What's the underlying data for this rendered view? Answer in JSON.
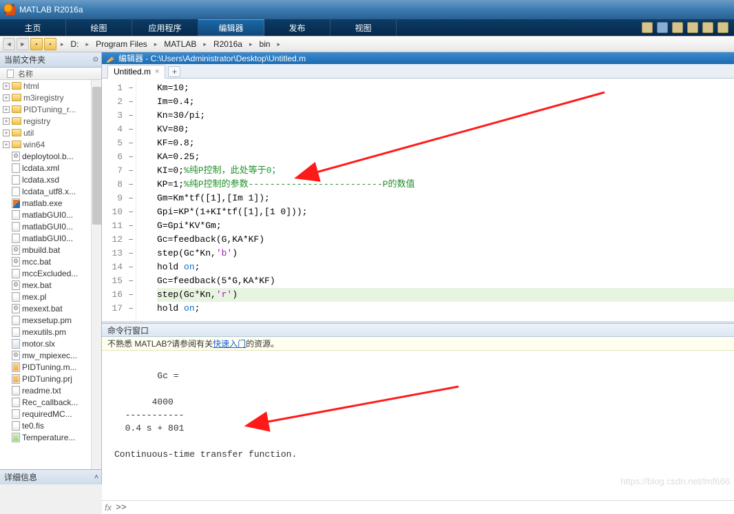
{
  "title_bar": {
    "app_title": "MATLAB R2016a"
  },
  "ribbon": {
    "tabs": [
      "主页",
      "绘图",
      "应用程序",
      "编辑器",
      "发布",
      "视图"
    ],
    "active_index": 3
  },
  "address": {
    "crumbs": [
      "D:",
      "Program Files",
      "MATLAB",
      "R2016a",
      "bin"
    ]
  },
  "file_browser": {
    "header": "当前文件夹",
    "column": "名称",
    "details_header": "详细信息",
    "folders": [
      "html",
      "m3iregistry",
      "PIDTuning_r...",
      "registry",
      "util",
      "win64"
    ],
    "files": [
      {
        "name": "deploytool.b...",
        "type": "bat"
      },
      {
        "name": "lcdata.xml",
        "type": "xml"
      },
      {
        "name": "lcdata.xsd",
        "type": "xml"
      },
      {
        "name": "lcdata_utf8.x...",
        "type": "xml"
      },
      {
        "name": "matlab.exe",
        "type": "exe"
      },
      {
        "name": "matlabGUI0...",
        "type": "m"
      },
      {
        "name": "matlabGUI0...",
        "type": "m"
      },
      {
        "name": "matlabGUI0...",
        "type": "m"
      },
      {
        "name": "mbuild.bat",
        "type": "bat"
      },
      {
        "name": "mcc.bat",
        "type": "bat"
      },
      {
        "name": "mccExcluded...",
        "type": "m"
      },
      {
        "name": "mex.bat",
        "type": "bat"
      },
      {
        "name": "mex.pl",
        "type": "m"
      },
      {
        "name": "mexext.bat",
        "type": "bat"
      },
      {
        "name": "mexsetup.pm",
        "type": "m"
      },
      {
        "name": "mexutils.pm",
        "type": "m"
      },
      {
        "name": "motor.slx",
        "type": "slx"
      },
      {
        "name": "mw_mpiexec...",
        "type": "bat"
      },
      {
        "name": "PIDTuning.m...",
        "type": "prj"
      },
      {
        "name": "PIDTuning.prj",
        "type": "prj"
      },
      {
        "name": "readme.txt",
        "type": "m"
      },
      {
        "name": "Rec_callback...",
        "type": "m"
      },
      {
        "name": "requiredMC...",
        "type": "m"
      },
      {
        "name": "te0.fis",
        "type": "m"
      },
      {
        "name": "Temperature...",
        "type": "green"
      }
    ]
  },
  "editor": {
    "window_title": "编辑器 - C:\\Users\\Administrator\\Desktop\\Untitled.m",
    "tab_name": "Untitled.m",
    "lines": [
      {
        "n": 1,
        "plain": "Km=10;"
      },
      {
        "n": 2,
        "plain": "Im=0.4;"
      },
      {
        "n": 3,
        "plain": "Kn=30/pi;"
      },
      {
        "n": 4,
        "plain": "KV=80;"
      },
      {
        "n": 5,
        "plain": "KF=0.8;"
      },
      {
        "n": 6,
        "plain": "KA=0.25;"
      },
      {
        "n": 7,
        "plain": "KI=0;",
        "comment": "%纯P控制，此处等于0；"
      },
      {
        "n": 8,
        "plain": "KP=1;",
        "comment": "%纯P控制的参数-------------------------P的数值"
      },
      {
        "n": 9,
        "plain": "Gm=Km*tf([1],[Im 1]);"
      },
      {
        "n": 10,
        "plain": "Gpi=KP*(1+KI*tf([1],[1 0]));"
      },
      {
        "n": 11,
        "plain": "G=Gpi*KV*Gm;"
      },
      {
        "n": 12,
        "plain": "Gc=feedback(G,KA*KF)"
      },
      {
        "n": 13,
        "pre": "step(Gc*Kn,",
        "str": "'b'",
        "post": ")"
      },
      {
        "n": 14,
        "pre": "hold ",
        "kw": "on",
        "post": ";"
      },
      {
        "n": 15,
        "plain": "Gc=feedback(5*G,KA*KF)"
      },
      {
        "n": 16,
        "pre": "step(Gc*Kn,",
        "str": "'r'",
        "post": ")",
        "hl": true
      },
      {
        "n": 17,
        "pre": "hold ",
        "kw": "on",
        "post": ";"
      }
    ]
  },
  "command": {
    "title": "命令行窗口",
    "tip_pre": "不熟悉 MATLAB?请参阅有关",
    "tip_link": "快速入门",
    "tip_post": "的资源。",
    "output": "Gc =\n\n       4000\n  -----------\n  0.4 s + 801\n\nContinuous-time transfer function.",
    "fx": "fx",
    "prompt": ">>",
    "watermark": "https://blog.csdn.net/lmf666"
  }
}
